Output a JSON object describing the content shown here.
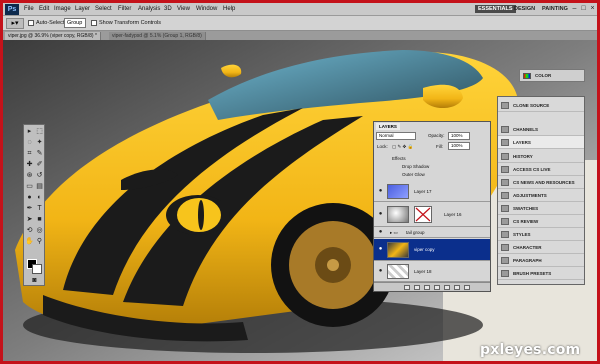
{
  "menubar": {
    "app_icon": "Ps",
    "items": [
      "File",
      "Edit",
      "Image",
      "Layer",
      "Select",
      "Filter",
      "Analysis",
      "3D",
      "View",
      "Window",
      "Help"
    ],
    "workspaces": [
      "ESSENTIALS",
      "DESIGN",
      "PAINTING"
    ],
    "active_workspace": "ESSENTIALS",
    "window_controls": [
      "–",
      "□",
      "×"
    ]
  },
  "options_bar": {
    "auto_select_label": "Auto-Select:",
    "auto_select_value": "Group",
    "transform_label": "Show Transform Controls"
  },
  "tabs": [
    {
      "label": "viper.jpg @ 36.9% (viper copy, RGB/8) *",
      "active": true
    },
    {
      "label": "viper-fadypsd @ 5.1% (Group 1, RGB/8)",
      "active": false
    }
  ],
  "layers_panel": {
    "tab_label": "LAYERS",
    "blend_mode": "Normal",
    "opacity_label": "Opacity:",
    "opacity_value": "100%",
    "lock_label": "Lock:",
    "fill_label": "Fill:",
    "fill_value": "100%",
    "effects_label": "Effects",
    "effects": [
      "Drop Shadow",
      "Outer Glow"
    ],
    "layers": [
      {
        "name": "Layer 17",
        "active": false
      },
      {
        "name": "Layer 16",
        "active": false
      },
      {
        "name": "tail group",
        "active": false
      },
      {
        "name": "viper copy",
        "active": true
      },
      {
        "name": "Layer 18",
        "active": false
      }
    ]
  },
  "dock": {
    "color_label": "COLOR",
    "items": [
      "CLONE SOURCE",
      "CHANNELS",
      "LAYERS",
      "HISTORY",
      "ACCESS CS LIVE",
      "CS NEWS AND RESOURCES",
      "ADJUSTMENTS",
      "SWATCHES",
      "CS REVIEW",
      "STYLES",
      "CHARACTER",
      "PARAGRAPH",
      "BRUSH PRESETS"
    ],
    "selected": "LAYERS"
  },
  "watermark": "pxleyes.com",
  "colors": {
    "accent_border": "#c4121a",
    "active_layer": "#0b2f8c",
    "car_yellow": "#f2b516"
  }
}
